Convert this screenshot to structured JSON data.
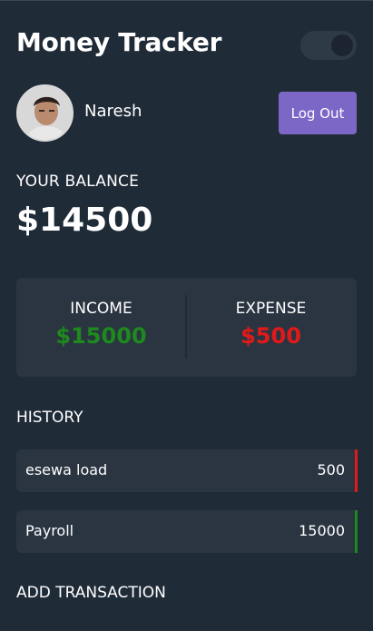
{
  "app": {
    "title": "Money Tracker"
  },
  "user": {
    "name": "Naresh",
    "logout_label": "Log Out"
  },
  "balance": {
    "label": "YOUR BALANCE",
    "amount": "$14500"
  },
  "summary": {
    "income_label": "INCOME",
    "income_amount": "$15000",
    "expense_label": "EXPENSE",
    "expense_amount": "$500"
  },
  "history": {
    "label": "HISTORY",
    "items": [
      {
        "name": "esewa load",
        "amount": "500",
        "type": "expense"
      },
      {
        "name": "Payroll",
        "amount": "15000",
        "type": "income"
      }
    ]
  },
  "add_transaction": {
    "label": "ADD TRANSACTION"
  },
  "colors": {
    "income": "#1e8a1e",
    "expense": "#e01a1a",
    "accent": "#7c67c7"
  },
  "icons": {
    "avatar": "user-avatar-photo",
    "theme_toggle": "theme-toggle"
  }
}
